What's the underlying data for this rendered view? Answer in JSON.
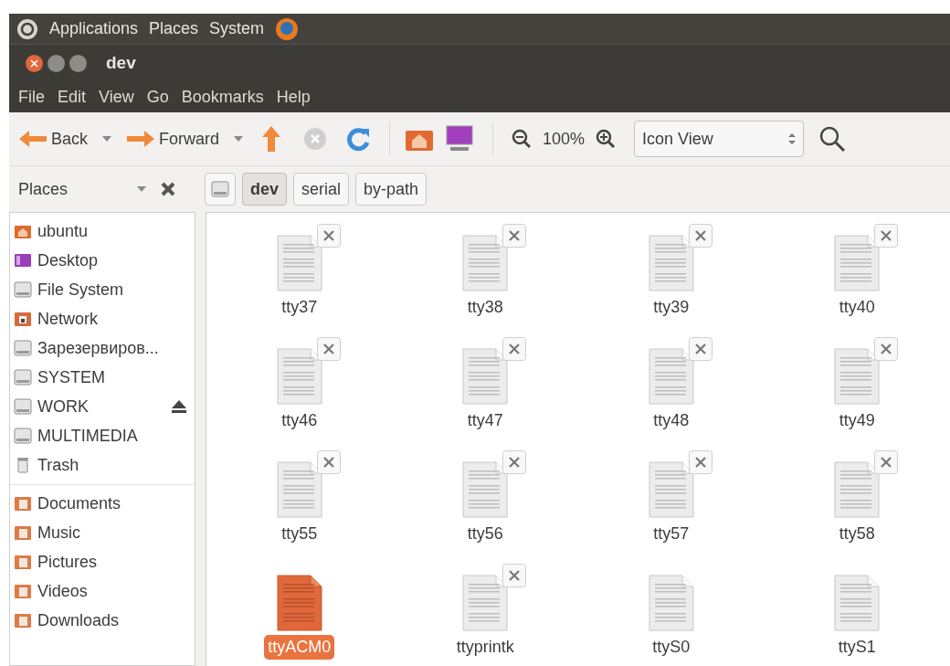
{
  "top_panel": {
    "menus": [
      "Applications",
      "Places",
      "System"
    ]
  },
  "window": {
    "title": "dev"
  },
  "menu_bar": [
    "File",
    "Edit",
    "View",
    "Go",
    "Bookmarks",
    "Help"
  ],
  "toolbar": {
    "back": "Back",
    "forward": "Forward",
    "zoom": "100%",
    "view": "Icon View"
  },
  "location_bar": {
    "side_pane": "Places",
    "path": [
      {
        "label": "dev",
        "selected": true
      },
      {
        "label": "serial",
        "selected": false
      },
      {
        "label": "by-path",
        "selected": false
      }
    ]
  },
  "sidebar": {
    "sections": [
      [
        {
          "label": "ubuntu",
          "kind": "home",
          "eject": false
        },
        {
          "label": "Desktop",
          "kind": "desktop",
          "eject": false
        },
        {
          "label": "File System",
          "kind": "drive",
          "eject": false
        },
        {
          "label": "Network",
          "kind": "network",
          "eject": false
        },
        {
          "label": "Зарезервиров...",
          "kind": "drive",
          "eject": false
        },
        {
          "label": "SYSTEM",
          "kind": "drive",
          "eject": false
        },
        {
          "label": "WORK",
          "kind": "drive",
          "eject": true
        },
        {
          "label": "MULTIMEDIA",
          "kind": "drive",
          "eject": false
        },
        {
          "label": "Trash",
          "kind": "trash",
          "eject": false
        }
      ],
      [
        {
          "label": "Documents",
          "kind": "folder",
          "eject": false
        },
        {
          "label": "Music",
          "kind": "folder",
          "eject": false
        },
        {
          "label": "Pictures",
          "kind": "folder",
          "eject": false
        },
        {
          "label": "Videos",
          "kind": "folder",
          "eject": false
        },
        {
          "label": "Downloads",
          "kind": "folder",
          "eject": false
        }
      ]
    ]
  },
  "files": [
    {
      "name": "tty37",
      "locked": true,
      "selected": false
    },
    {
      "name": "tty38",
      "locked": true,
      "selected": false
    },
    {
      "name": "tty39",
      "locked": true,
      "selected": false
    },
    {
      "name": "tty40",
      "locked": true,
      "selected": false
    },
    {
      "name": "tty46",
      "locked": true,
      "selected": false
    },
    {
      "name": "tty47",
      "locked": true,
      "selected": false
    },
    {
      "name": "tty48",
      "locked": true,
      "selected": false
    },
    {
      "name": "tty49",
      "locked": true,
      "selected": false
    },
    {
      "name": "tty55",
      "locked": true,
      "selected": false
    },
    {
      "name": "tty56",
      "locked": true,
      "selected": false
    },
    {
      "name": "tty57",
      "locked": true,
      "selected": false
    },
    {
      "name": "tty58",
      "locked": true,
      "selected": false
    },
    {
      "name": "ttyACM0",
      "locked": false,
      "selected": true
    },
    {
      "name": "ttyprintk",
      "locked": true,
      "selected": false
    },
    {
      "name": "ttyS0",
      "locked": false,
      "selected": false
    },
    {
      "name": "ttyS1",
      "locked": false,
      "selected": false
    }
  ]
}
